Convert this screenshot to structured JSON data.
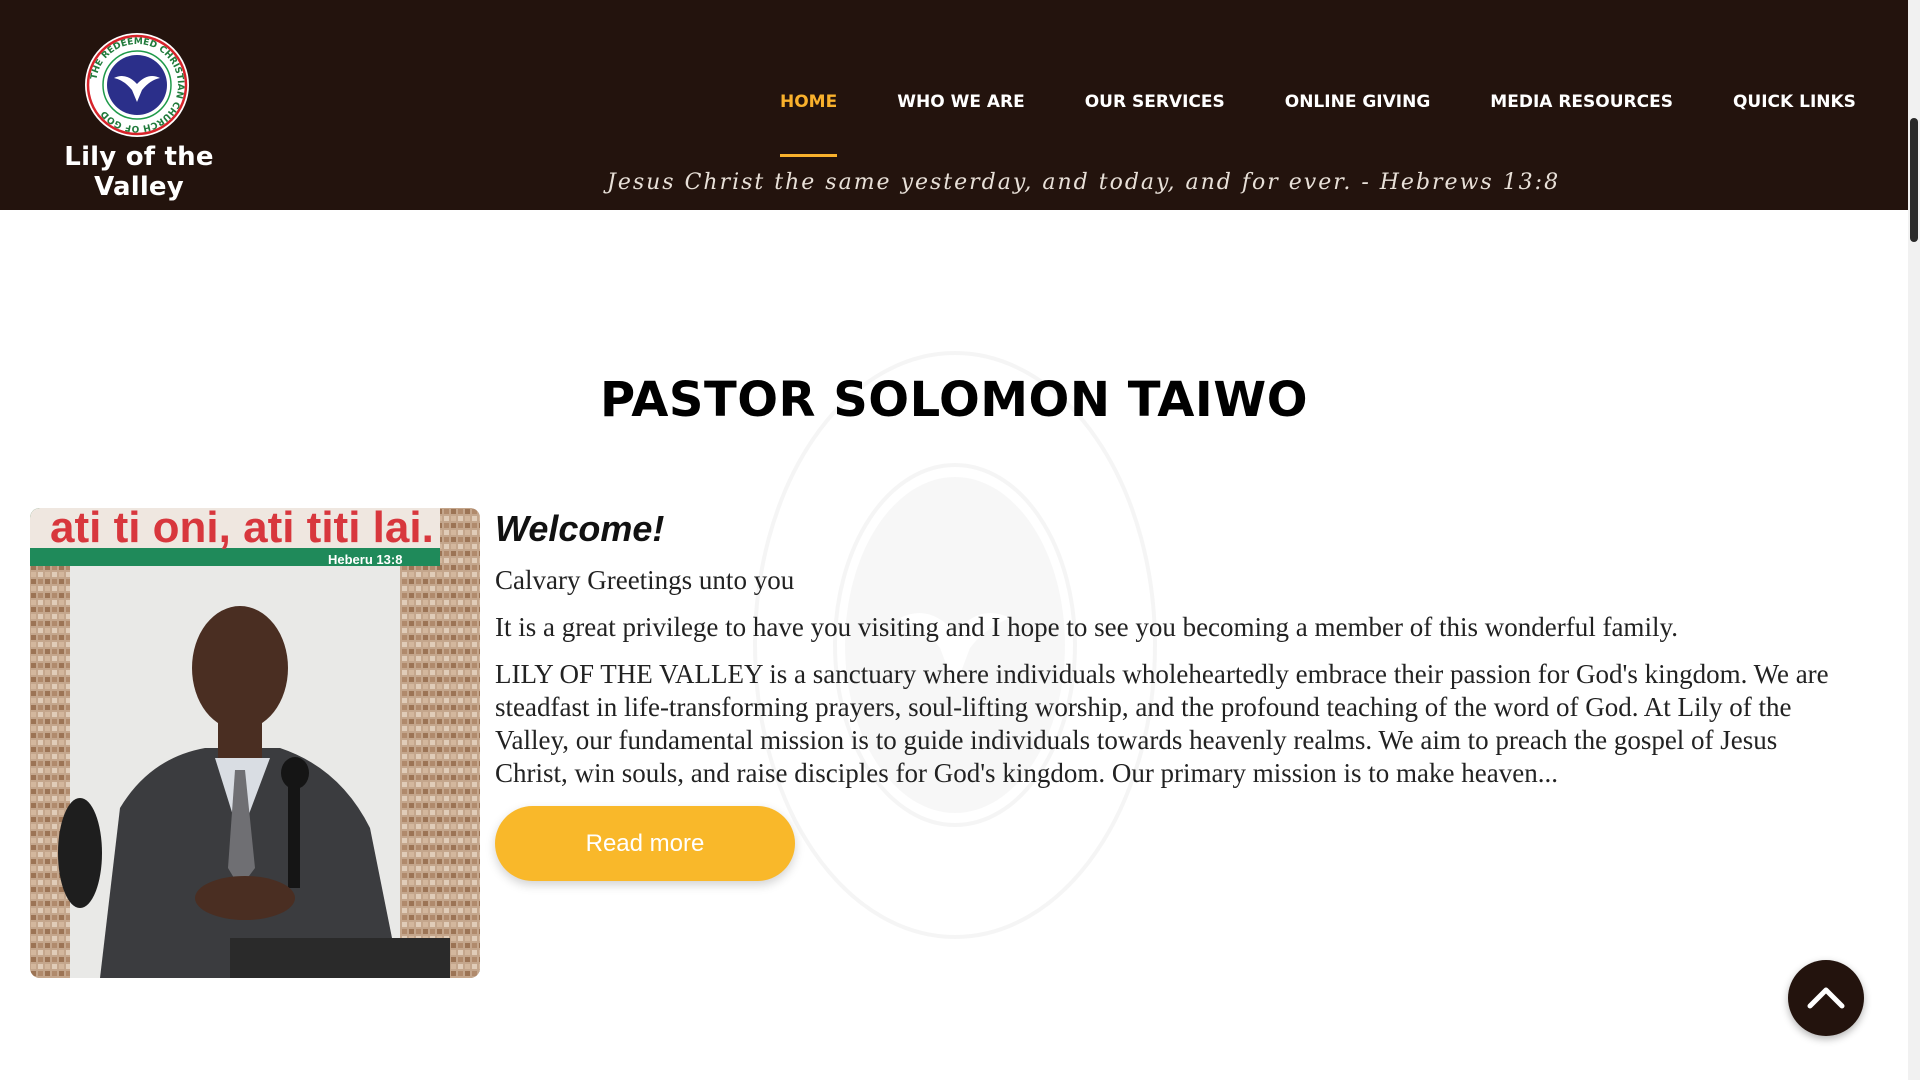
{
  "header": {
    "logo_ring_text": "THE REDEEMED CHRISTIAN CHURCH OF GOD",
    "site_name": "Lily of the Valley",
    "nav": [
      {
        "label": "HOME",
        "active": true
      },
      {
        "label": "WHO WE ARE",
        "active": false
      },
      {
        "label": "OUR SERVICES",
        "active": false
      },
      {
        "label": "ONLINE GIVING",
        "active": false
      },
      {
        "label": "MEDIA RESOURCES",
        "active": false
      },
      {
        "label": "QUICK LINKS",
        "active": false
      }
    ],
    "verse": "Jesus Christ the same yesterday, and today, and for ever. - Hebrews 13:8"
  },
  "main": {
    "title": "PASTOR SOLOMON TAIWO",
    "photo": {
      "banner_text": "ati ti oni, ati titi lai.",
      "banner_ref": "Heberu 13:8"
    },
    "welcome": "Welcome!",
    "greeting": "Calvary Greetings unto you",
    "intro": "It is a great privilege to have you visiting and I hope to see you becoming a member of this wonderful family.",
    "body": "LILY OF THE VALLEY is a sanctuary where individuals wholeheartedly embrace their passion for God's kingdom. We are steadfast in life-transforming prayers, soul-lifting worship, and the profound teaching of the word of God. At Lily of the Valley, our fundamental mission is to guide individuals towards heavenly realms. We aim to preach the gospel of Jesus Christ, win souls, and raise disciples for God's kingdom. Our primary mission is to make heaven...",
    "read_more": "Read more"
  },
  "colors": {
    "header_bg": "#23130d",
    "accent": "#f9b12c",
    "button": "#f9b82a"
  },
  "icons": {
    "back_to_top": "chevron-up-icon",
    "logo": "rccg-logo-icon"
  }
}
